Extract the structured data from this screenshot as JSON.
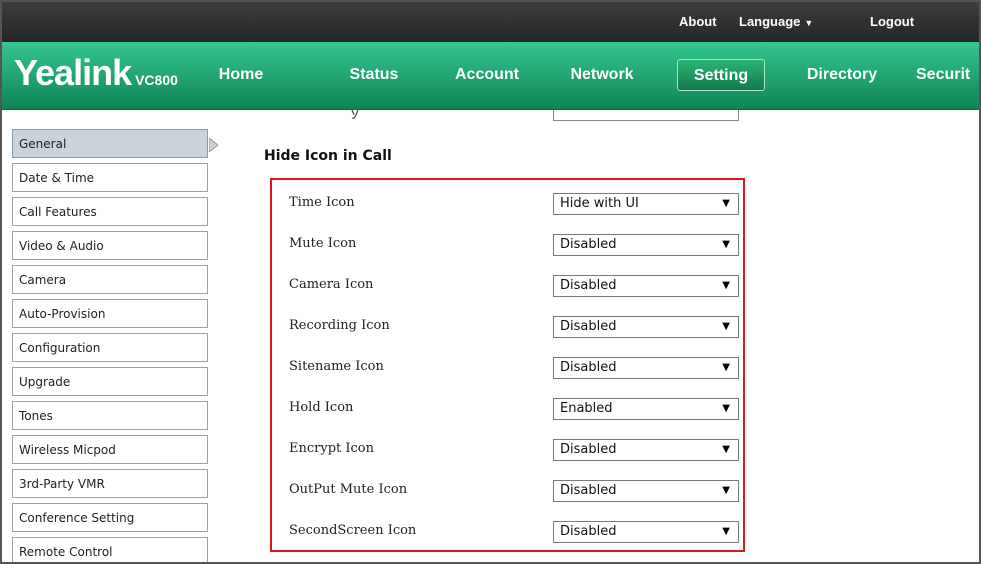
{
  "topbar": {
    "about": "About",
    "language": "Language",
    "logout": "Logout"
  },
  "logo": {
    "brand": "Yealink",
    "model": "VC800"
  },
  "nav": {
    "home": "Home",
    "status": "Status",
    "account": "Account",
    "network": "Network",
    "setting": "Setting",
    "directory": "Directory",
    "security": "Securit"
  },
  "sidebar": {
    "items": [
      "General",
      "Date & Time",
      "Call Features",
      "Video & Audio",
      "Camera",
      "Auto-Provision",
      "Configuration",
      "Upgrade",
      "Tones",
      "Wireless Micpod",
      "3rd-Party VMR",
      "Conference Setting",
      "Remote Control"
    ],
    "active": "General"
  },
  "section": {
    "title": "Hide Icon in Call"
  },
  "rows": [
    {
      "label": "Time Icon",
      "value": "Hide with UI"
    },
    {
      "label": "Mute Icon",
      "value": "Disabled"
    },
    {
      "label": "Camera Icon",
      "value": "Disabled"
    },
    {
      "label": "Recording Icon",
      "value": "Disabled"
    },
    {
      "label": "Sitename Icon",
      "value": "Disabled"
    },
    {
      "label": "Hold Icon",
      "value": "Enabled"
    },
    {
      "label": "Encrypt Icon",
      "value": "Disabled"
    },
    {
      "label": "OutPut Mute Icon",
      "value": "Disabled"
    },
    {
      "label": "SecondScreen Icon",
      "value": "Disabled"
    }
  ],
  "colors": {
    "nav_green": "#1ea367",
    "topbar_dark": "#2f2f2f",
    "highlight_red": "#e0141e",
    "sidebar_active": "#c9d3dc"
  },
  "icons": {
    "language_caret": "caret-down-icon",
    "select_arrow": "dropdown-arrow-icon"
  }
}
